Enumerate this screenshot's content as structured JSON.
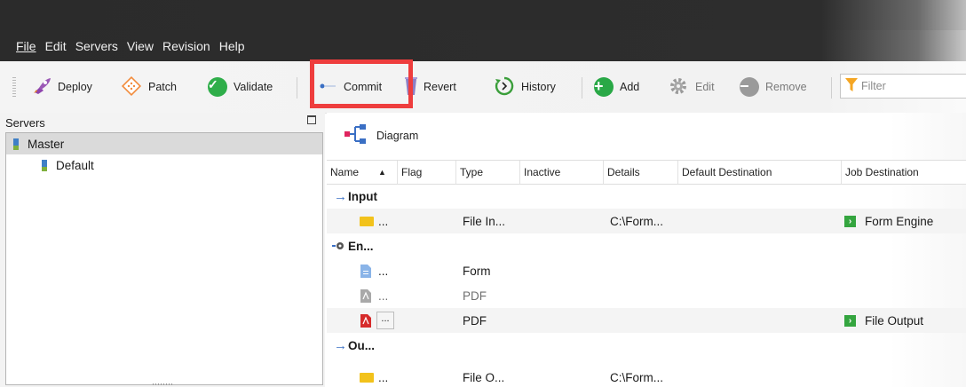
{
  "menu": [
    "File",
    "Edit",
    "Servers",
    "View",
    "Revision",
    "Help"
  ],
  "toolbar": {
    "deploy": "Deploy",
    "patch": "Patch",
    "validate": "Validate",
    "commit": "Commit",
    "revert": "Revert",
    "history": "History",
    "add": "Add",
    "edit": "Edit",
    "remove": "Remove",
    "filter_placeholder": "Filter"
  },
  "servers_panel": {
    "title": "Servers",
    "items": [
      {
        "label": "Master",
        "selected": true,
        "icon": "server-icon"
      },
      {
        "label": "Default",
        "selected": false,
        "icon": "server-icon"
      }
    ]
  },
  "main": {
    "diagram_label": "Diagram",
    "columns": [
      "Name",
      "Flag",
      "Type",
      "Inactive",
      "Details",
      "Default Destination",
      "Job Destination"
    ],
    "rows": [
      {
        "kind": "group",
        "icon": "arrow-right-icon",
        "name": "Input"
      },
      {
        "kind": "item",
        "icon": "folder-icon",
        "name": "...",
        "type": "File In...",
        "details": "C:\\Form...",
        "job_destination": "Form Engine",
        "alt": true
      },
      {
        "kind": "group",
        "icon": "engine-icon",
        "name": "En..."
      },
      {
        "kind": "item",
        "icon": "form-doc-icon",
        "name": "...",
        "type": "Form",
        "details": "",
        "job_destination": ""
      },
      {
        "kind": "item",
        "icon": "pdf-gray-icon",
        "name": "...",
        "type": "PDF",
        "details": "",
        "job_destination": "",
        "muted": true
      },
      {
        "kind": "item",
        "icon": "pdf-red-icon",
        "name": "...",
        "type": "PDF",
        "details": "",
        "job_destination": "File Output",
        "alt": true,
        "button": true
      },
      {
        "kind": "group",
        "icon": "arrow-right-icon",
        "name": "Ou..."
      },
      {
        "kind": "item",
        "icon": "folder-icon",
        "name": "...",
        "type": "File O...",
        "details": "C:\\Form...",
        "job_destination": ""
      }
    ]
  },
  "colors": {
    "highlight": "#ee3d3d",
    "validate_green": "#2fae4a",
    "history_green": "#3a9e3a",
    "add_green": "#29a846"
  }
}
